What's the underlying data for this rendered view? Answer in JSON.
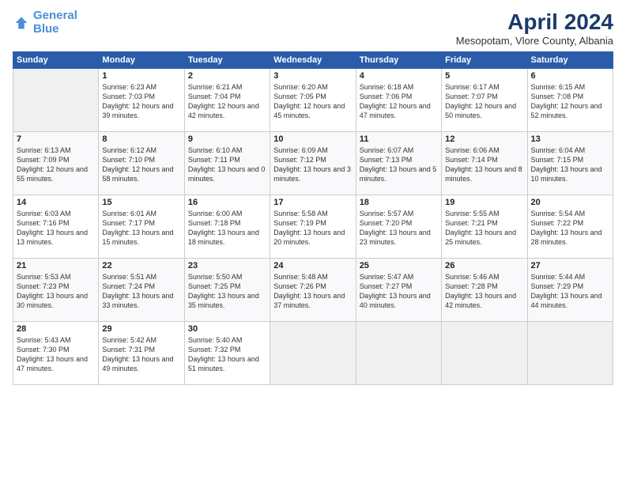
{
  "header": {
    "logo_line1": "General",
    "logo_line2": "Blue",
    "month_title": "April 2024",
    "location": "Mesopotam, Vlore County, Albania"
  },
  "days_of_week": [
    "Sunday",
    "Monday",
    "Tuesday",
    "Wednesday",
    "Thursday",
    "Friday",
    "Saturday"
  ],
  "weeks": [
    [
      {
        "day": "",
        "sunrise": "",
        "sunset": "",
        "daylight": ""
      },
      {
        "day": "1",
        "sunrise": "Sunrise: 6:23 AM",
        "sunset": "Sunset: 7:03 PM",
        "daylight": "Daylight: 12 hours and 39 minutes."
      },
      {
        "day": "2",
        "sunrise": "Sunrise: 6:21 AM",
        "sunset": "Sunset: 7:04 PM",
        "daylight": "Daylight: 12 hours and 42 minutes."
      },
      {
        "day": "3",
        "sunrise": "Sunrise: 6:20 AM",
        "sunset": "Sunset: 7:05 PM",
        "daylight": "Daylight: 12 hours and 45 minutes."
      },
      {
        "day": "4",
        "sunrise": "Sunrise: 6:18 AM",
        "sunset": "Sunset: 7:06 PM",
        "daylight": "Daylight: 12 hours and 47 minutes."
      },
      {
        "day": "5",
        "sunrise": "Sunrise: 6:17 AM",
        "sunset": "Sunset: 7:07 PM",
        "daylight": "Daylight: 12 hours and 50 minutes."
      },
      {
        "day": "6",
        "sunrise": "Sunrise: 6:15 AM",
        "sunset": "Sunset: 7:08 PM",
        "daylight": "Daylight: 12 hours and 52 minutes."
      }
    ],
    [
      {
        "day": "7",
        "sunrise": "Sunrise: 6:13 AM",
        "sunset": "Sunset: 7:09 PM",
        "daylight": "Daylight: 12 hours and 55 minutes."
      },
      {
        "day": "8",
        "sunrise": "Sunrise: 6:12 AM",
        "sunset": "Sunset: 7:10 PM",
        "daylight": "Daylight: 12 hours and 58 minutes."
      },
      {
        "day": "9",
        "sunrise": "Sunrise: 6:10 AM",
        "sunset": "Sunset: 7:11 PM",
        "daylight": "Daylight: 13 hours and 0 minutes."
      },
      {
        "day": "10",
        "sunrise": "Sunrise: 6:09 AM",
        "sunset": "Sunset: 7:12 PM",
        "daylight": "Daylight: 13 hours and 3 minutes."
      },
      {
        "day": "11",
        "sunrise": "Sunrise: 6:07 AM",
        "sunset": "Sunset: 7:13 PM",
        "daylight": "Daylight: 13 hours and 5 minutes."
      },
      {
        "day": "12",
        "sunrise": "Sunrise: 6:06 AM",
        "sunset": "Sunset: 7:14 PM",
        "daylight": "Daylight: 13 hours and 8 minutes."
      },
      {
        "day": "13",
        "sunrise": "Sunrise: 6:04 AM",
        "sunset": "Sunset: 7:15 PM",
        "daylight": "Daylight: 13 hours and 10 minutes."
      }
    ],
    [
      {
        "day": "14",
        "sunrise": "Sunrise: 6:03 AM",
        "sunset": "Sunset: 7:16 PM",
        "daylight": "Daylight: 13 hours and 13 minutes."
      },
      {
        "day": "15",
        "sunrise": "Sunrise: 6:01 AM",
        "sunset": "Sunset: 7:17 PM",
        "daylight": "Daylight: 13 hours and 15 minutes."
      },
      {
        "day": "16",
        "sunrise": "Sunrise: 6:00 AM",
        "sunset": "Sunset: 7:18 PM",
        "daylight": "Daylight: 13 hours and 18 minutes."
      },
      {
        "day": "17",
        "sunrise": "Sunrise: 5:58 AM",
        "sunset": "Sunset: 7:19 PM",
        "daylight": "Daylight: 13 hours and 20 minutes."
      },
      {
        "day": "18",
        "sunrise": "Sunrise: 5:57 AM",
        "sunset": "Sunset: 7:20 PM",
        "daylight": "Daylight: 13 hours and 23 minutes."
      },
      {
        "day": "19",
        "sunrise": "Sunrise: 5:55 AM",
        "sunset": "Sunset: 7:21 PM",
        "daylight": "Daylight: 13 hours and 25 minutes."
      },
      {
        "day": "20",
        "sunrise": "Sunrise: 5:54 AM",
        "sunset": "Sunset: 7:22 PM",
        "daylight": "Daylight: 13 hours and 28 minutes."
      }
    ],
    [
      {
        "day": "21",
        "sunrise": "Sunrise: 5:53 AM",
        "sunset": "Sunset: 7:23 PM",
        "daylight": "Daylight: 13 hours and 30 minutes."
      },
      {
        "day": "22",
        "sunrise": "Sunrise: 5:51 AM",
        "sunset": "Sunset: 7:24 PM",
        "daylight": "Daylight: 13 hours and 33 minutes."
      },
      {
        "day": "23",
        "sunrise": "Sunrise: 5:50 AM",
        "sunset": "Sunset: 7:25 PM",
        "daylight": "Daylight: 13 hours and 35 minutes."
      },
      {
        "day": "24",
        "sunrise": "Sunrise: 5:48 AM",
        "sunset": "Sunset: 7:26 PM",
        "daylight": "Daylight: 13 hours and 37 minutes."
      },
      {
        "day": "25",
        "sunrise": "Sunrise: 5:47 AM",
        "sunset": "Sunset: 7:27 PM",
        "daylight": "Daylight: 13 hours and 40 minutes."
      },
      {
        "day": "26",
        "sunrise": "Sunrise: 5:46 AM",
        "sunset": "Sunset: 7:28 PM",
        "daylight": "Daylight: 13 hours and 42 minutes."
      },
      {
        "day": "27",
        "sunrise": "Sunrise: 5:44 AM",
        "sunset": "Sunset: 7:29 PM",
        "daylight": "Daylight: 13 hours and 44 minutes."
      }
    ],
    [
      {
        "day": "28",
        "sunrise": "Sunrise: 5:43 AM",
        "sunset": "Sunset: 7:30 PM",
        "daylight": "Daylight: 13 hours and 47 minutes."
      },
      {
        "day": "29",
        "sunrise": "Sunrise: 5:42 AM",
        "sunset": "Sunset: 7:31 PM",
        "daylight": "Daylight: 13 hours and 49 minutes."
      },
      {
        "day": "30",
        "sunrise": "Sunrise: 5:40 AM",
        "sunset": "Sunset: 7:32 PM",
        "daylight": "Daylight: 13 hours and 51 minutes."
      },
      {
        "day": "",
        "sunrise": "",
        "sunset": "",
        "daylight": ""
      },
      {
        "day": "",
        "sunrise": "",
        "sunset": "",
        "daylight": ""
      },
      {
        "day": "",
        "sunrise": "",
        "sunset": "",
        "daylight": ""
      },
      {
        "day": "",
        "sunrise": "",
        "sunset": "",
        "daylight": ""
      }
    ]
  ]
}
